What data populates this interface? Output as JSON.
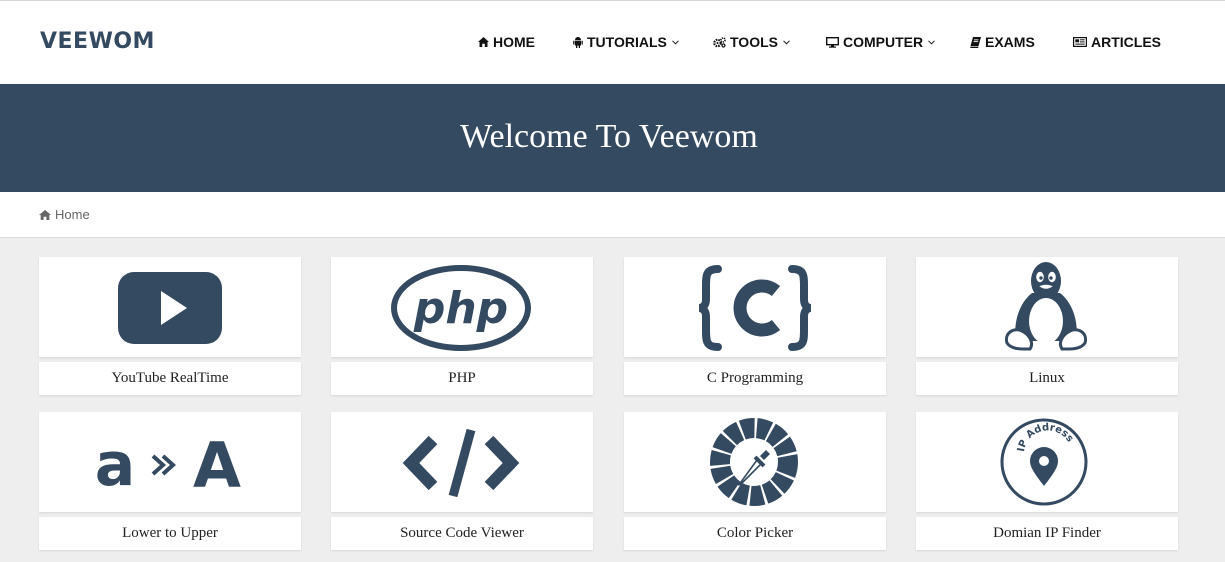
{
  "brand": "VEEWOM",
  "nav": [
    {
      "label": "HOME",
      "icon": "home-icon"
    },
    {
      "label": "TUTORIALS",
      "icon": "android-icon",
      "dropdown": true
    },
    {
      "label": "TOOLS",
      "icon": "gears-icon",
      "dropdown": true
    },
    {
      "label": "COMPUTER",
      "icon": "desktop-icon",
      "dropdown": true
    },
    {
      "label": "EXAMS",
      "icon": "book-icon"
    },
    {
      "label": "ARTICLES",
      "icon": "newspaper-icon"
    }
  ],
  "hero": {
    "title": "Welcome To Veewom"
  },
  "breadcrumb": {
    "label": "Home",
    "icon": "home-icon"
  },
  "cards": [
    {
      "label": "YouTube RealTime",
      "icon": "youtube-play-icon"
    },
    {
      "label": "PHP",
      "icon": "php-logo-icon"
    },
    {
      "label": "C Programming",
      "icon": "c-braces-icon"
    },
    {
      "label": "Linux",
      "icon": "tux-penguin-icon"
    },
    {
      "label": "Lower to Upper",
      "icon": "lower-to-upper-icon"
    },
    {
      "label": "Source Code Viewer",
      "icon": "code-brackets-icon"
    },
    {
      "label": "Color Picker",
      "icon": "color-picker-icon"
    },
    {
      "label": "Domian IP Finder",
      "icon": "ip-address-pin-icon"
    }
  ],
  "colors": {
    "primary": "#344a61",
    "background": "#eeeeee",
    "card": "#ffffff",
    "nav_text": "#111111"
  }
}
